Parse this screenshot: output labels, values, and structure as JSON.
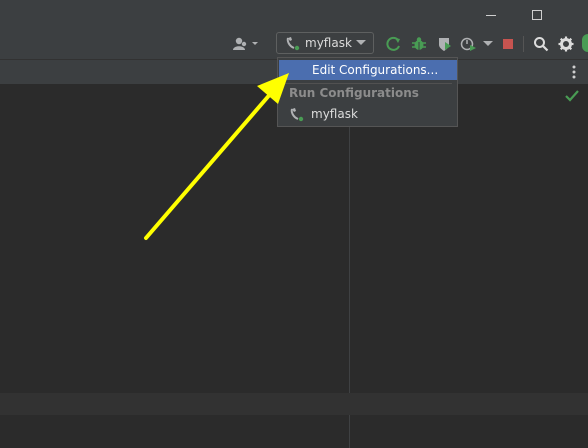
{
  "window": {
    "controls": [
      "minimize-icon",
      "maximize-icon"
    ]
  },
  "toolbar": {
    "run_config": {
      "label": "myflask",
      "icon": "python-run-config-icon"
    },
    "icons": [
      "user-icon",
      "chevron-down-icon",
      "rerun-icon",
      "debug-icon",
      "coverage-icon",
      "profile-icon",
      "chevron-down-icon",
      "stop-icon",
      "search-icon",
      "gear-icon"
    ],
    "colors": {
      "run_green": "#499c54",
      "stop_red": "#c75450",
      "accent_blue": "#4b6eaf"
    }
  },
  "dropdown": {
    "edit_configurations": "Edit Configurations...",
    "section_title": "Run Configurations",
    "configs": [
      {
        "label": "myflask",
        "icon": "python-run-config-icon"
      }
    ]
  },
  "tabstrip": {
    "icon": "more-vertical-icon"
  },
  "editor": {
    "status_icon": "checkmark-icon",
    "status_color": "#499c54"
  },
  "annotation": {
    "icon": "yellow-arrow",
    "color": "#ffff00"
  }
}
